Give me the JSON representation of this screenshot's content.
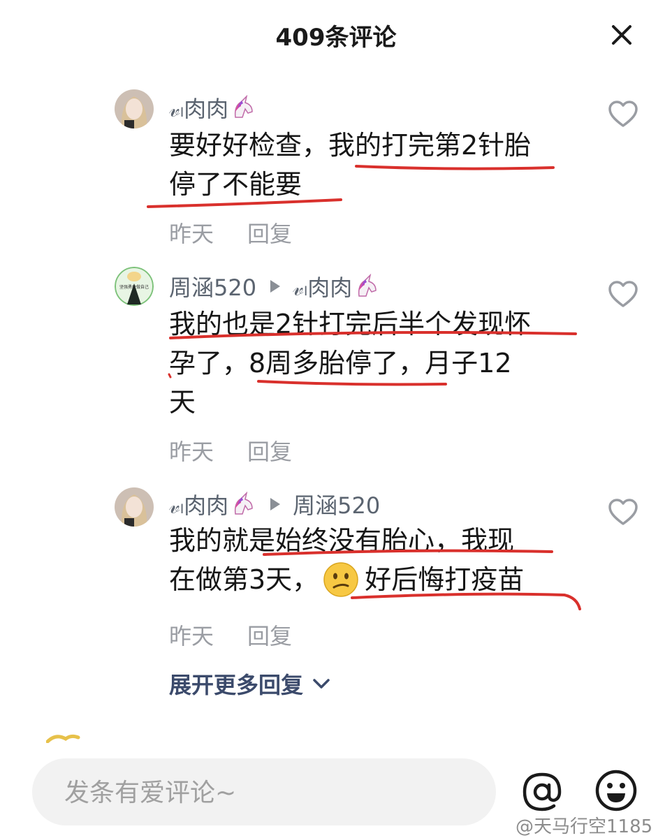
{
  "header": {
    "title": "409条评论"
  },
  "comments": [
    {
      "author": "𝓋ₗ肉肉",
      "reply_to": "",
      "lines": [
        "要好好检查，我的打完第2针胎",
        "停了不能要"
      ],
      "time": "昨天",
      "reply_label": "回复"
    },
    {
      "author": "周涵520",
      "reply_to": "𝓋ₗ肉肉",
      "lines": [
        "我的也是2针打完后半个发现怀",
        "孕了，8周多胎停了，月子12",
        "天"
      ],
      "time": "昨天",
      "reply_label": "回复",
      "avatar_caption": "坚强勇敢做自己"
    },
    {
      "author": "𝓋ₗ肉肉",
      "reply_to": "周涵520",
      "lines": [
        "我的就是始终没有胎心，我现",
        "在做第3天，",
        "好后悔打疫苗"
      ],
      "time": "昨天",
      "reply_label": "回复"
    }
  ],
  "expand_replies": "展开更多回复",
  "input": {
    "placeholder": "发条有爱评论~"
  },
  "watermark": "@天马行空1185",
  "colors": {
    "underline": "#d9302c",
    "expand": "#3b4a6b",
    "meta": "#9a9da3"
  },
  "icons": [
    "close-icon",
    "heart-icon",
    "unicorn-icon",
    "at-icon",
    "emoji-icon",
    "confused-emoji-icon"
  ]
}
